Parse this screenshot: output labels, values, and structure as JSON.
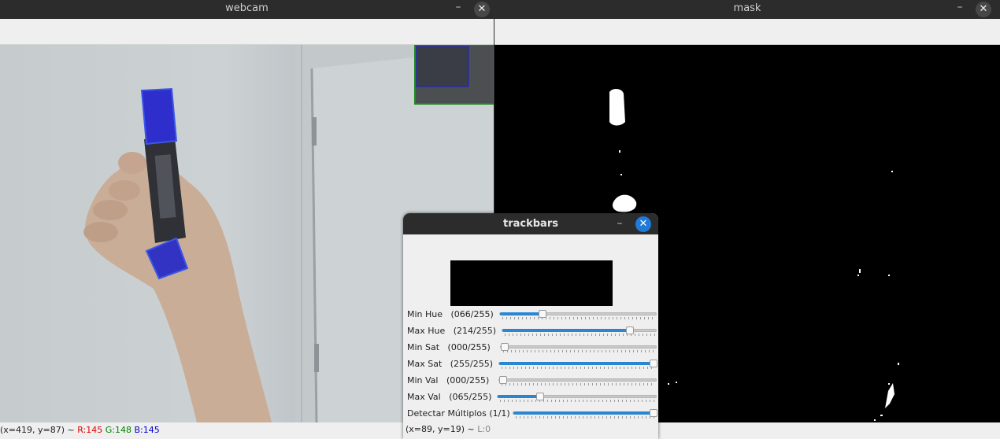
{
  "webcam": {
    "title": "webcam",
    "status": {
      "coords": "(x=419, y=87) ~",
      "r": "R:145",
      "g": "G:148",
      "b": "B:145",
      "r_color": "#e00000",
      "g_color": "#008000",
      "b_color": "#0000cc"
    }
  },
  "mask": {
    "title": "mask"
  },
  "trackbars": {
    "title": "trackbars",
    "rows": [
      {
        "label": "Min Hue   (066/255)",
        "fraction": 0.259
      },
      {
        "label": "Max Hue   (214/255)",
        "fraction": 0.839
      },
      {
        "label": "Min Sat   (000/255)",
        "fraction": 0.0
      },
      {
        "label": "Max Sat   (255/255)",
        "fraction": 1.0
      },
      {
        "label": "Min Val   (000/255)",
        "fraction": 0.0
      },
      {
        "label": "Max Val   (065/255)",
        "fraction": 0.255
      },
      {
        "label": "Detectar Múltiplos (1/1)",
        "fraction": 1.0
      }
    ],
    "status_coords": "(x=89, y=19) ~",
    "status_l": "L:0",
    "accent": "#2a86d1"
  },
  "window_buttons": {
    "minimize": "–",
    "close": "✕"
  }
}
